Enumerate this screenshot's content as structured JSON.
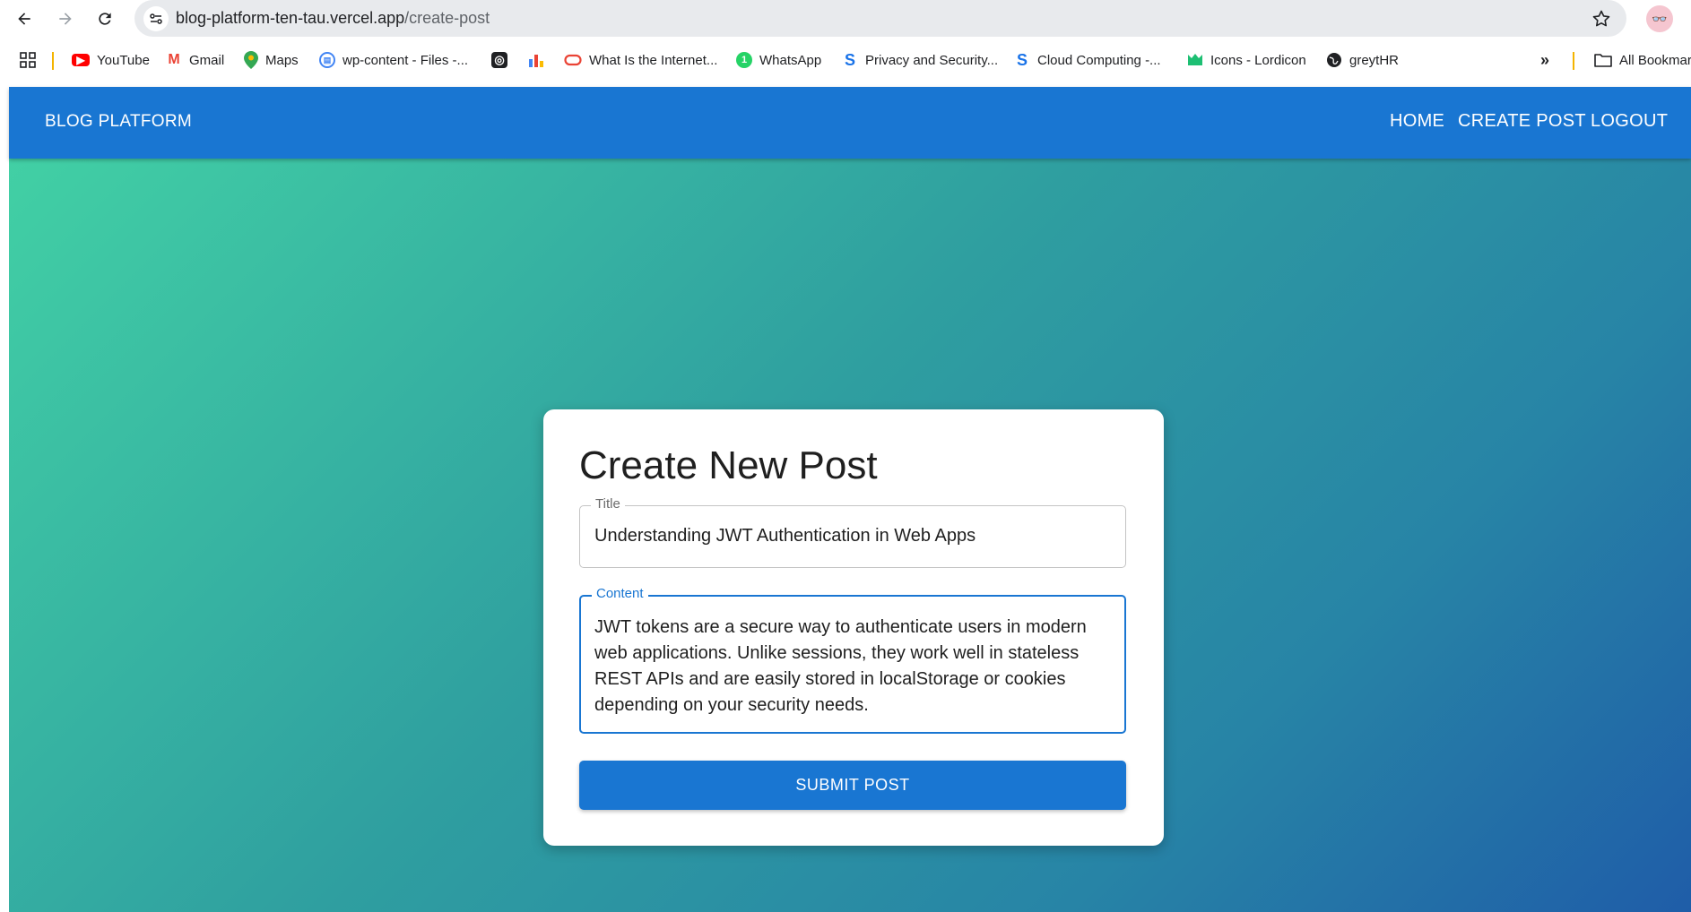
{
  "browser": {
    "url_host": "blog-platform-ten-tau.vercel.app",
    "url_path": "/create-post",
    "bookmarks": [
      {
        "label": "YouTube",
        "icon": "youtube-icon",
        "color": "#ff0000"
      },
      {
        "label": "Gmail",
        "icon": "gmail-icon",
        "color": "#ea4335"
      },
      {
        "label": "Maps",
        "icon": "maps-icon",
        "color": "#34a853"
      },
      {
        "label": "wp-content - Files -...",
        "icon": "files-icon",
        "color": "#4285f4"
      },
      {
        "label": "",
        "icon": "app-icon",
        "color": "#202124"
      },
      {
        "label": "",
        "icon": "analytics-icon",
        "color": "#f9ab00"
      },
      {
        "label": "What Is the Internet...",
        "icon": "oracle-icon",
        "color": "#ea4335"
      },
      {
        "label": "WhatsApp",
        "icon": "whatsapp-icon",
        "color": "#25d366"
      },
      {
        "label": "Privacy and Security...",
        "icon": "s-icon",
        "color": "#1a73e8"
      },
      {
        "label": "Cloud Computing -...",
        "icon": "s-icon",
        "color": "#1a73e8"
      },
      {
        "label": "Icons - Lordicon",
        "icon": "lordicon-icon",
        "color": "#1dbf73"
      },
      {
        "label": "greytHR",
        "icon": "globe-icon",
        "color": "#202124"
      }
    ],
    "more": "»",
    "all_bookmarks": "All Bookmar"
  },
  "appbar": {
    "brand": "BLOG PLATFORM",
    "nav": [
      "HOME",
      "CREATE POST",
      "LOGOUT"
    ]
  },
  "form": {
    "heading": "Create New Post",
    "title_label": "Title",
    "title_value": "Understanding JWT Authentication in Web Apps",
    "content_label": "Content",
    "content_value": "JWT tokens are a secure way to authenticate users in modern web applications. Unlike sessions, they work well in stateless REST APIs and are easily stored in localStorage or cookies depending on your security needs.",
    "submit_label": "SUBMIT POST"
  },
  "colors": {
    "primary": "#1976d2",
    "gradient_start": "#43d3a5",
    "gradient_end": "#1f5da8"
  }
}
